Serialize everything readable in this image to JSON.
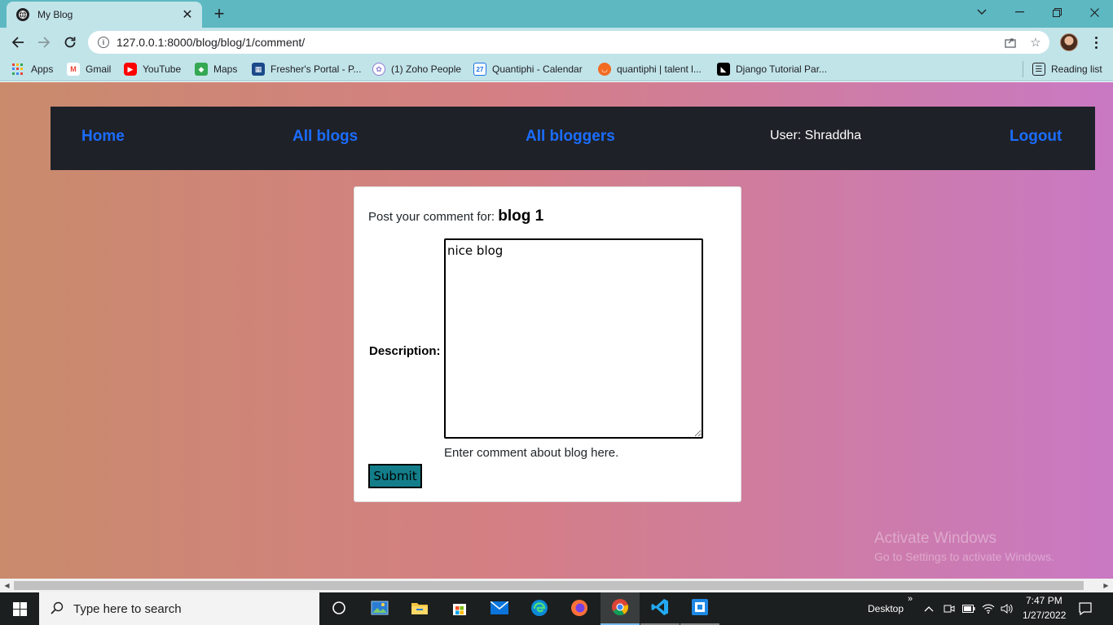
{
  "browser": {
    "tab": {
      "title": "My Blog"
    },
    "address": {
      "url": "127.0.0.1:8000/blog/blog/1/comment/"
    },
    "bookmarks": [
      {
        "label": "Apps",
        "icon": "apps-grid-icon"
      },
      {
        "label": "Gmail",
        "icon": "gmail-icon"
      },
      {
        "label": "YouTube",
        "icon": "youtube-icon"
      },
      {
        "label": "Maps",
        "icon": "maps-icon"
      },
      {
        "label": "Fresher's Portal - P...",
        "icon": "portal-icon"
      },
      {
        "label": "(1) Zoho People",
        "icon": "zoho-icon"
      },
      {
        "label": "Quantiphi - Calendar",
        "icon": "calendar-icon"
      },
      {
        "label": "quantiphi | talent l...",
        "icon": "talent-icon"
      },
      {
        "label": "Django Tutorial Par...",
        "icon": "django-icon"
      }
    ],
    "reading_list": "Reading list"
  },
  "page": {
    "nav": {
      "home": "Home",
      "all_blogs": "All blogs",
      "all_bloggers": "All bloggers",
      "user": "User: Shraddha",
      "logout": "Logout"
    },
    "form": {
      "post_label": "Post your comment for:",
      "blog_title": "blog 1",
      "description_label": "Description:",
      "description_value": "nice blog",
      "help_text": "Enter comment about blog here.",
      "submit_label": "Submit"
    },
    "watermark": {
      "line1": "Activate Windows",
      "line2": "Go to Settings to activate Windows."
    }
  },
  "taskbar": {
    "search_placeholder": "Type here to search",
    "desktop_label": "Desktop",
    "time": "7:47 PM",
    "date": "1/27/2022"
  },
  "colors": {
    "nav_link": "#1a6dff",
    "nav_bg": "#1f2128",
    "submit_bg": "#137e8a",
    "tab_strip": "#5db8c2",
    "toolbar": "#c1e4e9"
  }
}
